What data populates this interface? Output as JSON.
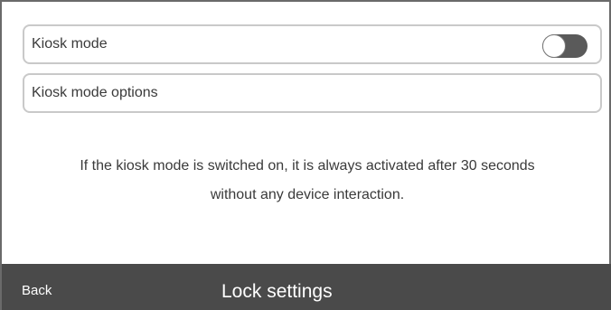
{
  "settings": {
    "kiosk_mode_label": "Kiosk mode",
    "kiosk_mode_enabled": false,
    "kiosk_options_label": "Kiosk mode options"
  },
  "info": {
    "line1": "If the kiosk mode is switched on, it is always activated after 30 seconds",
    "line2": "without any device interaction."
  },
  "footer": {
    "back_label": "Back",
    "title": "Lock settings"
  },
  "colors": {
    "footer_bg": "#4a4a4a",
    "toggle_track": "#5a5a5a",
    "row_border": "#c9c9c9"
  },
  "icons": {
    "toggle": "toggle-switch-icon"
  }
}
